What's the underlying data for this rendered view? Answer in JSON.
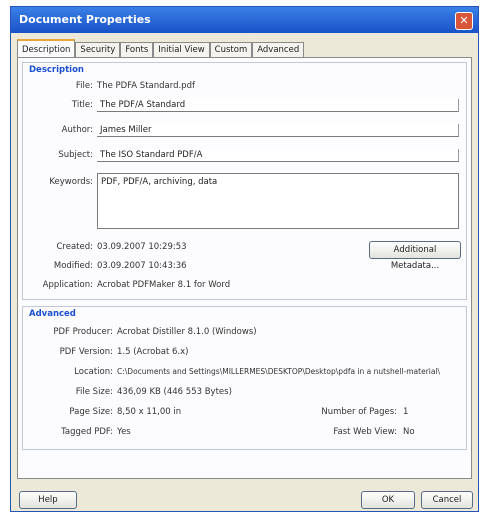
{
  "window": {
    "title": "Document Properties",
    "close_glyph": "✕"
  },
  "tabs": [
    "Description",
    "Security",
    "Fonts",
    "Initial View",
    "Custom",
    "Advanced"
  ],
  "description": {
    "section_title": "Description",
    "file_label": "File:",
    "file_value": "The PDFA Standard.pdf",
    "title_label": "Title:",
    "title_value": "The PDF/A Standard",
    "author_label": "Author:",
    "author_value": "James Miller",
    "subject_label": "Subject:",
    "subject_value": "The ISO Standard PDF/A",
    "keywords_label": "Keywords:",
    "keywords_value": "PDF, PDF/A, archiving, data",
    "created_label": "Created:",
    "created_value": "03.09.2007 10:29:53",
    "modified_label": "Modified:",
    "modified_value": "03.09.2007 10:43:36",
    "application_label": "Application:",
    "application_value": "Acrobat PDFMaker 8.1 for Word",
    "metadata_button": "Additional Metadata..."
  },
  "advanced": {
    "section_title": "Advanced",
    "producer_label": "PDF Producer:",
    "producer_value": "Acrobat Distiller 8.1.0 (Windows)",
    "version_label": "PDF Version:",
    "version_value": "1.5 (Acrobat 6.x)",
    "location_label": "Location:",
    "location_value": "C:\\Documents and Settings\\MILLERMES\\DESKTOP\\Desktop\\pdfa in a nutshell-material\\",
    "filesize_label": "File Size:",
    "filesize_value": "436,09 KB (446 553 Bytes)",
    "pagesize_label": "Page Size:",
    "pagesize_value": "8,50 x 11,00 in",
    "pages_label": "Number of Pages:",
    "pages_value": "1",
    "tagged_label": "Tagged PDF:",
    "tagged_value": "Yes",
    "fastweb_label": "Fast Web View:",
    "fastweb_value": "No"
  },
  "footer": {
    "help": "Help",
    "ok": "OK",
    "cancel": "Cancel"
  }
}
